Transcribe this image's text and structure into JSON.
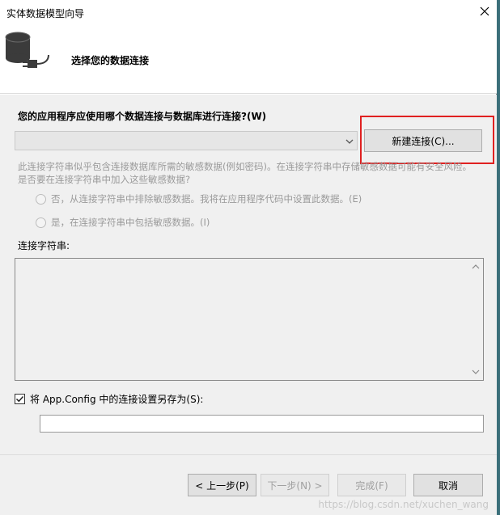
{
  "window": {
    "title": "实体数据模型向导",
    "close_glyph": "✕"
  },
  "header": {
    "title": "选择您的数据连接",
    "icon": "database-plug-icon"
  },
  "question": {
    "text": "您的应用程序应使用哪个数据连接与数据库进行连接?(W)"
  },
  "connection_select": {
    "value": "",
    "arrow": "chevron-down-icon"
  },
  "new_connection_button": {
    "label": "新建连接(C)..."
  },
  "sensitive": {
    "description": "此连接字符串似乎包含连接数据库所需的敏感数据(例如密码)。在连接字符串中存储敏感数据可能有安全风险。是否要在连接字符串中加入这些敏感数据?",
    "option_no": "否，从连接字符串中排除敏感数据。我将在应用程序代码中设置此数据。(E)",
    "option_yes": "是，在连接字符串中包括敏感数据。(I)"
  },
  "connection_string": {
    "label": "连接字符串:",
    "value": ""
  },
  "save_config": {
    "checked": true,
    "label": "将 App.Config 中的连接设置另存为(S):",
    "value": ""
  },
  "footer": {
    "back_label": "< 上一步(P)",
    "next_label": "下一步(N) >",
    "finish_label": "完成(F)",
    "cancel_label": "取消"
  },
  "watermark": "https://blog.csdn.net/xuchen_wang",
  "colors": {
    "highlight": "#e02020",
    "content_bg": "#f0f0f0"
  }
}
